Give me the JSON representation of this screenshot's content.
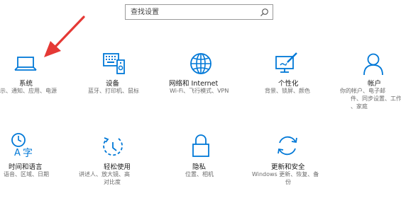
{
  "search": {
    "placeholder": "查找设置"
  },
  "tiles": [
    {
      "title": "系统",
      "desc": "示、通知、应用、电源",
      "icon": "laptop-icon"
    },
    {
      "title": "设备",
      "desc": "蓝牙、打印机、鼠标",
      "icon": "devices-icon"
    },
    {
      "title": "网络和 Internet",
      "desc": "Wi-Fi、飞行模式、VPN",
      "icon": "globe-icon"
    },
    {
      "title": "个性化",
      "desc": "背景、锁屏、颜色",
      "icon": "personalization-icon"
    },
    {
      "title": "帐户",
      "desc_lines": [
        "你的帐户、电子邮",
        "件、同步设置、工作",
        "、家庭"
      ],
      "icon": "person-icon"
    },
    {
      "title": "时间和语言",
      "desc": "语音、区域、日期",
      "icon": "time-language-icon"
    },
    {
      "title": "轻松使用",
      "desc_lines": [
        "讲述人、放大镜、高",
        "对比度"
      ],
      "icon": "ease-of-access-icon"
    },
    {
      "title": "隐私",
      "desc": "位置、相机",
      "icon": "lock-icon"
    },
    {
      "title": "更新和安全",
      "desc_lines": [
        "Windows 更新、恢复、备",
        "份"
      ],
      "icon": "sync-icon"
    }
  ],
  "colors": {
    "accent": "#0078d7",
    "arrow": "#e53935"
  }
}
